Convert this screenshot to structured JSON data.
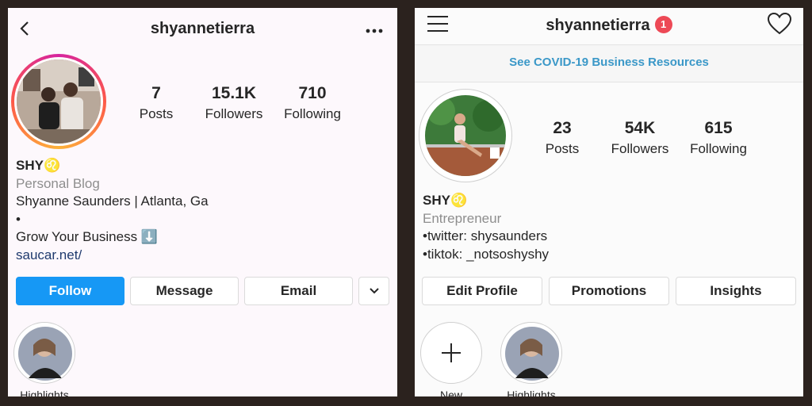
{
  "left": {
    "username": "shyannetierra",
    "stats": [
      {
        "value": "7",
        "label": "Posts"
      },
      {
        "value": "15.1K",
        "label": "Followers"
      },
      {
        "value": "710",
        "label": "Following"
      }
    ],
    "bio": {
      "name": "SHY♌",
      "category": "Personal Blog",
      "line1": "Shyanne Saunders | Atlanta, Ga",
      "line2": "•",
      "line3": "Grow Your Business ⬇️",
      "link": "saucar.net/"
    },
    "buttons": {
      "follow": "Follow",
      "message": "Message",
      "email": "Email"
    },
    "highlights": [
      {
        "label": "Highlights"
      }
    ]
  },
  "right": {
    "username": "shyannetierra",
    "notification_count": "1",
    "covid_banner": "See COVID-19 Business Resources",
    "stats": [
      {
        "value": "23",
        "label": "Posts"
      },
      {
        "value": "54K",
        "label": "Followers"
      },
      {
        "value": "615",
        "label": "Following"
      }
    ],
    "bio": {
      "name": "SHY♌",
      "category": "Entrepreneur",
      "line1": "•twitter: shysaunders",
      "line2": "•tiktok: _notsoshyshy"
    },
    "buttons": {
      "edit_profile": "Edit Profile",
      "promotions": "Promotions",
      "insights": "Insights"
    },
    "highlights": [
      {
        "label": "New"
      },
      {
        "label": "Highlights"
      }
    ]
  },
  "colors": {
    "accent_blue": "#1698f5",
    "link_blue": "#3b98c8",
    "badge_red": "#ed4956",
    "muted_text": "#8e8e8e"
  },
  "icons": [
    "back-chevron-icon",
    "more-dots-icon",
    "hamburger-menu-icon",
    "heart-icon",
    "chevron-down-icon",
    "plus-icon"
  ]
}
